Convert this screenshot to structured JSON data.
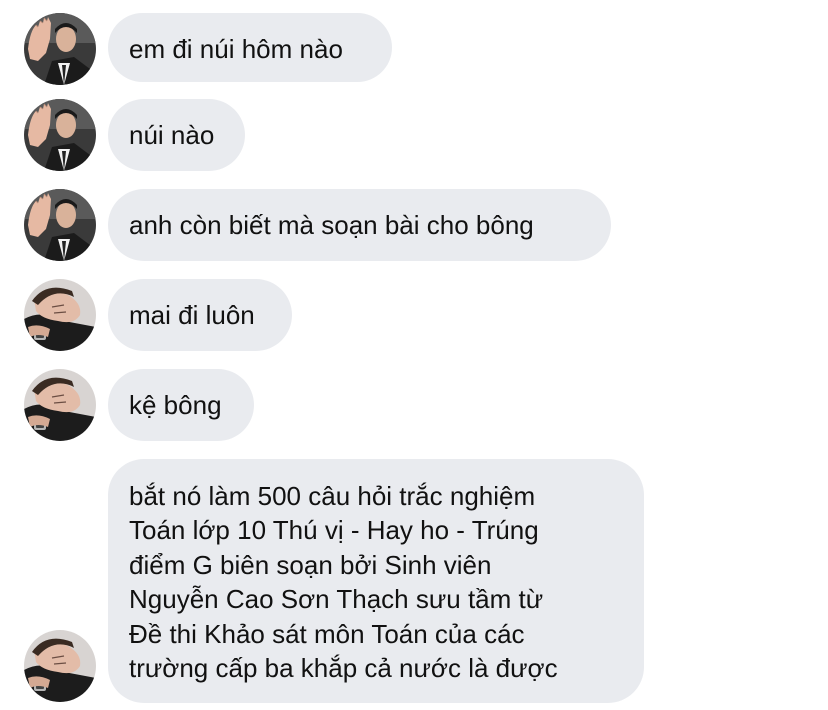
{
  "messages": [
    {
      "avatar": "man-waving-avatar-icon",
      "text": "em đi núi hôm nào"
    },
    {
      "avatar": "man-waving-avatar-icon",
      "text": "núi nào"
    },
    {
      "avatar": "man-waving-avatar-icon",
      "text": "anh còn biết mà soạn bài cho bông"
    },
    {
      "avatar": "man-lying-avatar-icon",
      "text": "mai đi luôn"
    },
    {
      "avatar": "man-lying-avatar-icon",
      "text": "kệ bông"
    },
    {
      "avatar": "man-lying-avatar-icon",
      "lines": [
        "bắt nó làm 500 câu hỏi trắc nghiệm",
        "Toán lớp 10 Thú vị - Hay ho - Trúng",
        "điểm G biên soạn bởi Sinh viên",
        "Nguyễn Cao Sơn Thạch sưu tầm từ",
        "Đề thi Khảo sát môn Toán của các",
        "trường cấp ba khắp cả nước là được"
      ]
    }
  ],
  "colors": {
    "bubble": "#e9ebef",
    "text": "#111111",
    "background": "#ffffff"
  }
}
